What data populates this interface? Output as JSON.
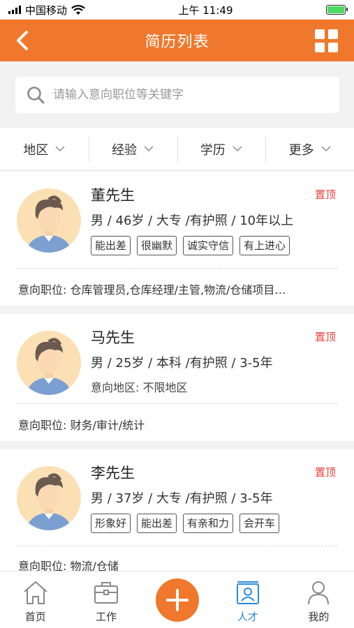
{
  "status_bar": {
    "carrier": "中国移动",
    "time": "上午 11:49",
    "battery_level": 1.0
  },
  "nav": {
    "title": "简历列表",
    "back_icon": "back-arrow-icon",
    "menu_icon": "grid-icon"
  },
  "search": {
    "placeholder": "请输入意向职位等关键字"
  },
  "filters": [
    {
      "label": "地区"
    },
    {
      "label": "经验"
    },
    {
      "label": "学历"
    },
    {
      "label": "更多"
    }
  ],
  "resumes": [
    {
      "name": "董先生",
      "pin": "置顶",
      "info": "男 / 46岁 / 大专 /有护照 / 10年以上",
      "tags": [
        "能出差",
        "很幽默",
        "诚实守信",
        "有上进心"
      ],
      "region": "",
      "job": "意向职位: 仓库管理员,仓库经理/主管,物流/仓储项目…"
    },
    {
      "name": "马先生",
      "pin": "置顶",
      "info": "男 / 25岁 / 本科 /有护照 / 3-5年",
      "tags": [],
      "region": "意向地区: 不限地区",
      "job": "意向职位: 财务/审计/统计"
    },
    {
      "name": "李先生",
      "pin": "置顶",
      "info": "男 / 37岁 / 大专 /有护照 / 3-5年",
      "tags": [
        "形象好",
        "能出差",
        "有亲和力",
        "会开车"
      ],
      "region": "",
      "job": "意向职位: 物流/仓储"
    }
  ],
  "tab_bar": {
    "items": [
      {
        "label": "首页",
        "icon": "home-icon"
      },
      {
        "label": "工作",
        "icon": "briefcase-icon"
      },
      {
        "label": "",
        "icon": "plus-icon"
      },
      {
        "label": "人才",
        "icon": "talent-icon",
        "active": true
      },
      {
        "label": "我的",
        "icon": "user-icon"
      }
    ]
  },
  "colors": {
    "primary": "#f0782c",
    "pin": "#e8403a",
    "active_tab": "#2a8ad9"
  }
}
